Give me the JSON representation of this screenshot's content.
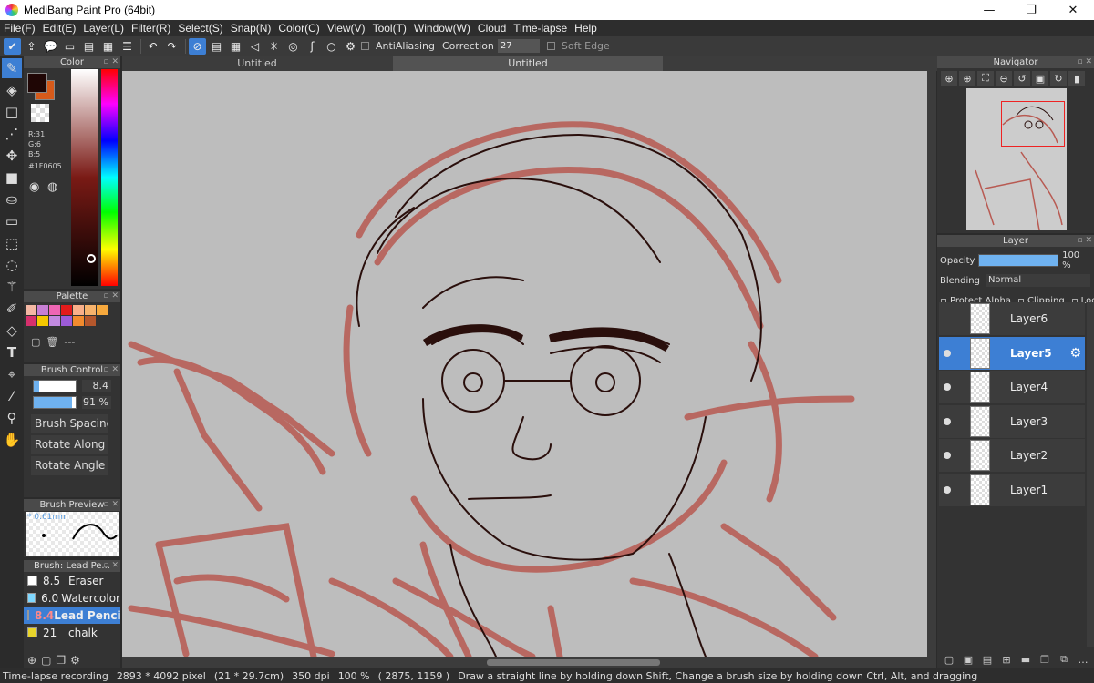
{
  "window": {
    "title": "MediBang Paint Pro (64bit)",
    "minimize": "—",
    "maximize": "❐",
    "close": "✕"
  },
  "menu": [
    "File(F)",
    "Edit(E)",
    "Layer(L)",
    "Filter(R)",
    "Select(S)",
    "Snap(N)",
    "Color(C)",
    "View(V)",
    "Tool(T)",
    "Window(W)",
    "Cloud",
    "Time-lapse",
    "Help"
  ],
  "toolbar": {
    "antialiasing": "AntiAliasing",
    "correction_label": "Correction",
    "correction_value": "27",
    "soft_edge": "Soft Edge"
  },
  "tabs": [
    "Untitled",
    "Untitled"
  ],
  "color": {
    "panel_title": "Color",
    "r": "R:31",
    "g": "G:6",
    "b": "B:5",
    "hex": "#1F0605",
    "main": "#1f0605",
    "sub": "#d65a1a"
  },
  "palette": {
    "panel_title": "Palette",
    "colors": [
      "#f4b8a4",
      "#c77fd4",
      "#ee66b4",
      "#e21b1b",
      "#f9b08a",
      "#f7b36c",
      "#f7a93d",
      "#d6306d",
      "#f5c800",
      "#c28ae0",
      "#9c5bd8",
      "#f28b2e",
      "#b5572c",
      ""
    ],
    "dash": "---"
  },
  "brush_control": {
    "panel_title": "Brush Control",
    "size": "8.4",
    "size_fraction": 0.12,
    "opacity": "91 %",
    "opacity_fraction": 0.91,
    "options": [
      "Brush Spacing",
      "Rotate Along",
      "Rotate Angle"
    ]
  },
  "brush_preview": {
    "panel_title": "Brush Preview",
    "size": "* 0.61mm"
  },
  "brush_list": {
    "panel_title": "Brush: Lead Pe...",
    "items": [
      {
        "size": "8.5",
        "name": "Eraser",
        "color": "#ffffff",
        "selected": false
      },
      {
        "size": "6.0",
        "name": "Watercolor",
        "color": "#7fd8ff",
        "selected": false
      },
      {
        "size": "8.4",
        "name": "Lead Pencil",
        "color": "#e8d42a",
        "selected": true
      },
      {
        "size": "21",
        "name": "chalk",
        "color": "#e8d42a",
        "selected": false
      }
    ]
  },
  "navigator": {
    "panel_title": "Navigator"
  },
  "layer_panel": {
    "panel_title": "Layer",
    "opacity_label": "Opacity",
    "opacity_value": "100 %",
    "opacity_fraction": 1.0,
    "blending_label": "Blending",
    "blending_value": "Normal",
    "protect_alpha": "Protect Alpha",
    "clipping": "Clipping",
    "lock": "Lock",
    "layers": [
      {
        "name": "Layer6",
        "visible": false,
        "selected": false
      },
      {
        "name": "Layer5",
        "visible": true,
        "selected": true
      },
      {
        "name": "Layer4",
        "visible": true,
        "selected": false
      },
      {
        "name": "Layer3",
        "visible": true,
        "selected": false
      },
      {
        "name": "Layer2",
        "visible": true,
        "selected": false
      },
      {
        "name": "Layer1",
        "visible": true,
        "selected": false
      }
    ]
  },
  "status": {
    "recording": "Time-lapse recording",
    "pixels": "2893 * 4092 pixel",
    "cm": "(21 * 29.7cm)",
    "dpi": "350 dpi",
    "zoom": "100 %",
    "coords": "( 2875, 1159 )",
    "hint": "Draw a straight line by holding down Shift, Change a brush size by holding down Ctrl, Alt, and dragging"
  },
  "colors": {
    "accent": "#3d7fd4",
    "canvas_bg": "#bdbdbd",
    "sketch_red": "#b85a52",
    "lineart": "#2a0f0c"
  }
}
